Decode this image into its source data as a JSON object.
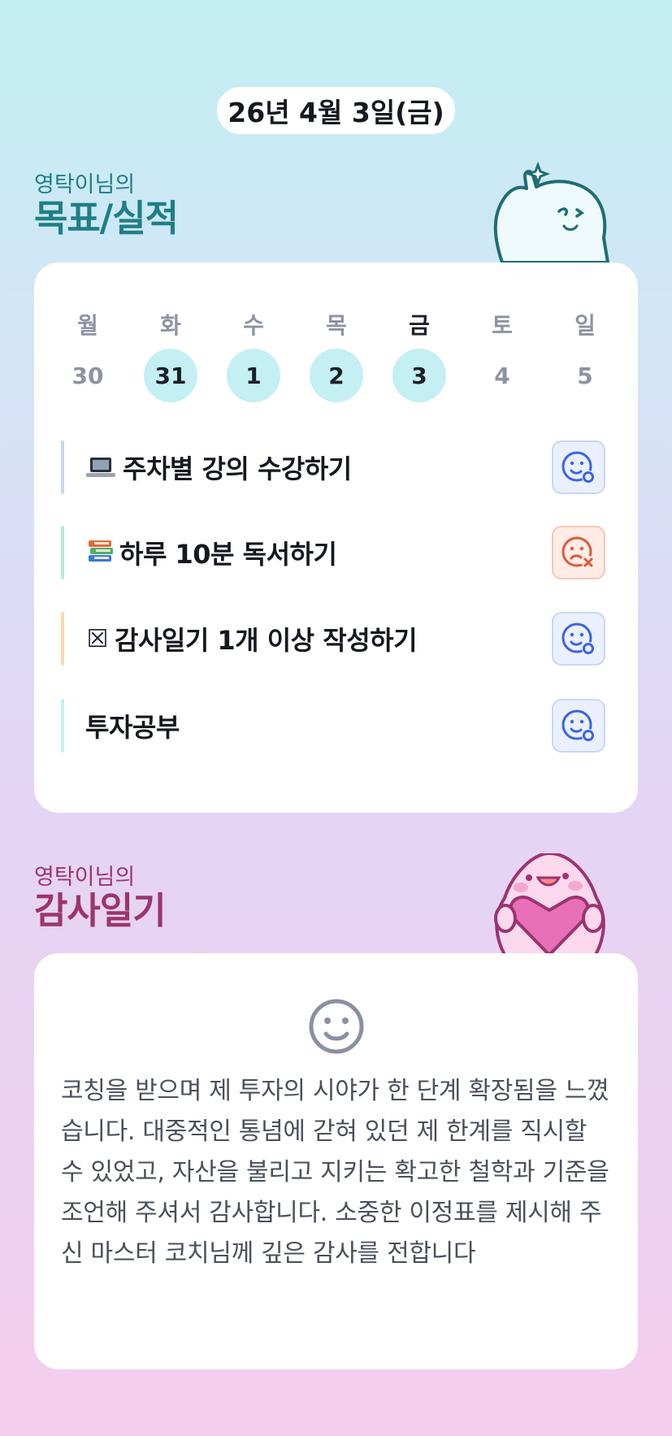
{
  "date": "26년 4월 3일(금)",
  "goals_section": {
    "subtitle": "영탁이님의",
    "title": "목표/실적"
  },
  "week": {
    "days": [
      {
        "name": "월",
        "num": "30",
        "marked": false,
        "today": false
      },
      {
        "name": "화",
        "num": "31",
        "marked": true,
        "today": false
      },
      {
        "name": "수",
        "num": "1",
        "marked": true,
        "today": false
      },
      {
        "name": "목",
        "num": "2",
        "marked": true,
        "today": false
      },
      {
        "name": "금",
        "num": "3",
        "marked": true,
        "today": true
      },
      {
        "name": "토",
        "num": "4",
        "marked": false,
        "today": false
      },
      {
        "name": "일",
        "num": "5",
        "marked": false,
        "today": false
      }
    ]
  },
  "goals": [
    {
      "emoji": "💻",
      "label": "주차별 강의 수강하기",
      "status": "achieved",
      "bar_color": "#c9d6f7"
    },
    {
      "emoji": "📚",
      "label": "하루 10분 독서하기",
      "status": "missed",
      "bar_color": "#b6ecd8"
    },
    {
      "emoji": "☒",
      "label": "감사일기 1개 이상 작성하기",
      "status": "achieved",
      "bar_color": "#ffd9a8"
    },
    {
      "emoji": "",
      "label": "투자공부",
      "status": "achieved",
      "bar_color": "#c4f0f3"
    }
  ],
  "gratitude_section": {
    "subtitle": "영탁이님의",
    "title": "감사일기"
  },
  "diary": {
    "icon": "smile-icon",
    "text": "코칭을 받으며 제 투자의 시야가 한 단계 확장됨을 느꼈습니다. 대중적인 통념에 갇혀 있던 제 한계를 직시할 수 있었고, 자산을 불리고 지키는 확고한 철학과 기준을 조언해 주셔서 감사합니다. 소중한 이정표를 제시해 주신 마스터 코치님께 깊은 감사를 전합니다"
  },
  "colors": {
    "accent_teal": "#1f7f86",
    "accent_plum": "#9c3470",
    "achieved_icon": "#3b63e6",
    "missed_icon": "#e0583b",
    "marked_day_bg": "#c4f0f3"
  }
}
